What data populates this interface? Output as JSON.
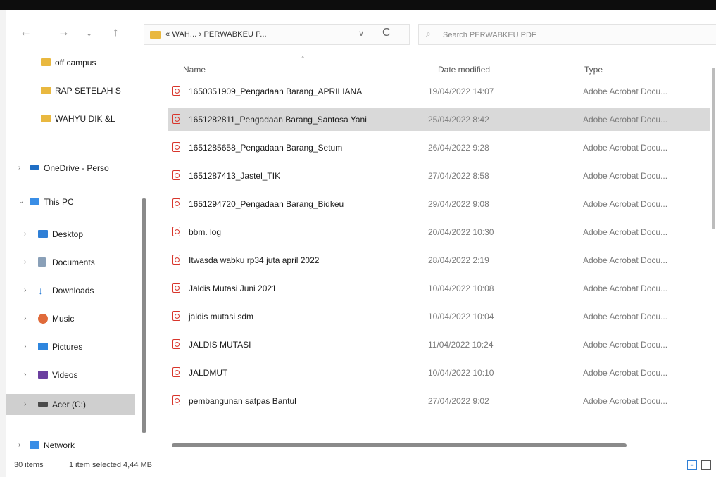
{
  "nav": {
    "back_icon": "back-arrow-icon",
    "forward_icon": "forward-arrow-icon",
    "recent_icon": "chevron-down-icon",
    "up_icon": "up-arrow-icon"
  },
  "address": {
    "path": "« WAH... › PERWABKEU P...",
    "dropdown": "∨",
    "refresh": "C"
  },
  "search": {
    "placeholder": "Search PERWABKEU PDF"
  },
  "sidebar": {
    "items": [
      {
        "label": "off campus"
      },
      {
        "label": "RAP SETELAH S"
      },
      {
        "label": "WAHYU DIK &L"
      },
      {
        "label": "OneDrive - Perso"
      },
      {
        "label": "This PC"
      },
      {
        "label": "Desktop"
      },
      {
        "label": "Documents"
      },
      {
        "label": "Downloads"
      },
      {
        "label": "Music"
      },
      {
        "label": "Pictures"
      },
      {
        "label": "Videos"
      },
      {
        "label": "Acer (C:)"
      },
      {
        "label": "Network"
      }
    ]
  },
  "columns": {
    "name": "Name",
    "date": "Date modified",
    "type": "Type"
  },
  "files": [
    {
      "name": "1650351909_Pengadaan Barang_APRILIANA",
      "date": "19/04/2022 14:07",
      "type": "Adobe Acrobat Docu..."
    },
    {
      "name": "1651282811_Pengadaan Barang_Santosa Yani",
      "date": "25/04/2022 8:42",
      "type": "Adobe Acrobat Docu..."
    },
    {
      "name": "1651285658_Pengadaan Barang_Setum",
      "date": "26/04/2022 9:28",
      "type": "Adobe Acrobat Docu..."
    },
    {
      "name": "1651287413_Jastel_TIK",
      "date": "27/04/2022 8:58",
      "type": "Adobe Acrobat Docu..."
    },
    {
      "name": "1651294720_Pengadaan Barang_Bidkeu",
      "date": "29/04/2022 9:08",
      "type": "Adobe Acrobat Docu..."
    },
    {
      "name": "bbm. log",
      "date": "20/04/2022 10:30",
      "type": "Adobe Acrobat Docu..."
    },
    {
      "name": "Itwasda wabku rp34 juta april 2022",
      "date": "28/04/2022 2:19",
      "type": "Adobe Acrobat Docu..."
    },
    {
      "name": "Jaldis Mutasi Juni 2021",
      "date": "10/04/2022 10:08",
      "type": "Adobe Acrobat Docu..."
    },
    {
      "name": "jaldis mutasi sdm",
      "date": "10/04/2022 10:04",
      "type": "Adobe Acrobat Docu..."
    },
    {
      "name": "JALDIS MUTASI",
      "date": "11/04/2022 10:24",
      "type": "Adobe Acrobat Docu..."
    },
    {
      "name": "JALDMUT",
      "date": "10/04/2022 10:10",
      "type": "Adobe Acrobat Docu..."
    },
    {
      "name": "pembangunan satpas Bantul",
      "date": "27/04/2022 9:02",
      "type": "Adobe Acrobat Docu..."
    }
  ],
  "status": {
    "count": "30 items",
    "selection": "1 item selected  4,44 MB"
  },
  "colors": {
    "folder": "#e9b83f",
    "pdf": "#d8352b",
    "onedrive": "#1f6fc5",
    "thispc": "#3a8ee6",
    "selected": "#d9d9d9"
  }
}
